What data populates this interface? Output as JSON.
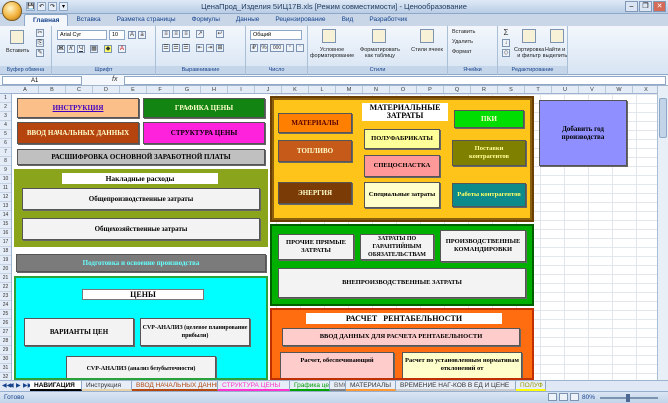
{
  "window": {
    "title": "ЦенаПрод_Изделия 5ИЦ17В.xls  [Режим совместимости] - Ценообразование",
    "qat": [
      "💾",
      "↶",
      "↷",
      "▾"
    ],
    "controls": [
      "–",
      "❐",
      "✕"
    ]
  },
  "ribbon_tabs": [
    "Главная",
    "Вставка",
    "Разметка страницы",
    "Формулы",
    "Данные",
    "Рецензирование",
    "Вид",
    "Разработчик"
  ],
  "ribbon": {
    "clipboard": {
      "paste": "Вставить",
      "label": "Буфер обмена"
    },
    "font": {
      "name": "Arial Cyr",
      "size": "10",
      "bold": "Ж",
      "italic": "К",
      "underline": "Ч",
      "label": "Шрифт"
    },
    "alignment": {
      "label": "Выравнивание"
    },
    "number": {
      "format": "Общий",
      "label": "Число",
      "percent": "%",
      "thousands": "000"
    },
    "styles": {
      "conditional": "Условное форматирование",
      "table": "Форматировать как таблицу",
      "cell": "Стили ячеек",
      "label": "Стили"
    },
    "cells": {
      "insert": "Вставить",
      "delete": "Удалить",
      "format": "Формат",
      "label": "Ячейки"
    },
    "editing": {
      "sort": "Сортировка и фильтр",
      "find": "Найти и выделить",
      "label": "Редактирование",
      "sigma": "Σ"
    }
  },
  "formula_bar": {
    "cell": "A1",
    "fx": "fx",
    "value": ""
  },
  "columns": [
    "A",
    "B",
    "C",
    "D",
    "E",
    "F",
    "G",
    "H",
    "I",
    "J",
    "K",
    "L",
    "M",
    "N",
    "O",
    "P",
    "Q",
    "R",
    "S",
    "T",
    "U",
    "V",
    "W",
    "X"
  ],
  "rows": [
    "1",
    "2",
    "3",
    "4",
    "5",
    "6",
    "7",
    "8",
    "9",
    "10",
    "11",
    "12",
    "13",
    "14",
    "15",
    "16",
    "17",
    "18",
    "19",
    "20",
    "21",
    "22",
    "23",
    "24",
    "25",
    "26",
    "27",
    "28",
    "29",
    "30",
    "31",
    "32"
  ],
  "left_block": {
    "instruction": "ИНСТРУКЦИЯ",
    "price_graph": "ГРАФИКА ЦЕНЫ",
    "input_data": "ВВОД НАЧАЛЬНЫХ ДАННЫХ",
    "price_structure": "СТРУКТУРА ЦЕНЫ",
    "salary": "РАСШИФРОВКА ОСНОВНОЙ ЗАРАБОТНОЙ ПЛАТЫ",
    "overhead_title": "Накладные расходы",
    "general_production": "Общепроизводственные затраты",
    "general_business": "Общехозяйственные затраты",
    "preparation": "Подготовка и освоение производства",
    "prices_title": "ЦЕНЫ",
    "price_variants": "ВАРИАНТЫ ЦЕН",
    "cvp_analysis": "CVP-АНАЛИЗ (целевое планирование прибыли)",
    "cvp_breakeven": "CVP-АНАЛИЗ (анализ безубыточности)"
  },
  "middle_block": {
    "material_title": "МАТЕРИАЛЬНЫЕ ЗАТРАТЫ",
    "materials": "МАТЕРИАЛЫ",
    "pki": "ПКИ",
    "semi": "ПОЛУФАБРИКАТЫ",
    "fuel": "ТОПЛИВО",
    "contractor_supplies": "Поставки контрагентов",
    "special_clothes": "СПЕЦОСНАСТКА",
    "energy": "ЭНЕРГИЯ",
    "special_costs": "Специальные затраты",
    "contractor_work": "Работы контрагентов",
    "other_direct": "ПРОЧИЕ ПРЯМЫЕ ЗАТРАТЫ",
    "warranty": "ЗАТРАТЫ ПО ГАРАНТИЙНЫМ ОБЯЗАТЕЛЬСТВАМ",
    "business_trips": "ПРОИЗВОДСТВЕННЫЕ КОМАНДИРОВКИ",
    "non_production": "ВНЕПРОИЗВОДСТВЕННЫЕ ЗАТРАТЫ",
    "profit_title": "РАСЧЕТ   РЕНТАБЕЛЬНОСТИ",
    "profit_input": "ВВОД ДАННЫХ ДЛЯ РАСЧЕТА РЕНТАБЕЛЬНОСТИ",
    "profit_calc": "Расчет, обеспечивающий",
    "profit_norm": "Расчет по установленным нормативам отклонений от"
  },
  "right_block": {
    "add_year": "Добавить год производства"
  },
  "sheet_tabs": [
    {
      "label": "НАВИГАЦИЯ",
      "color": "#ffffff",
      "text": "#000000",
      "active": true
    },
    {
      "label": "Инструкция",
      "color": "#e8d3a9",
      "text": "#333333",
      "active": false
    },
    {
      "label": "ВВОД НАЧАЛЬНЫХ ДАННЫХ",
      "color": "#b5470f",
      "text": "#b5470f",
      "active": false
    },
    {
      "label": "СТРУКТУРА ЦЕНЫ",
      "color": "#ff33cc",
      "text": "#ff33cc",
      "active": false
    },
    {
      "label": "Графика цены",
      "color": "#00a000",
      "text": "#00a000",
      "active": false
    },
    {
      "label": "ВМС",
      "color": "#808080",
      "text": "#666666",
      "active": false
    },
    {
      "label": "МАТЕРИАЛЫ",
      "color": "#ff9933",
      "text": "#333333",
      "active": false
    },
    {
      "label": "ВРЕМЕНИЕ НАГ-КОВ В ЕД И ЦЕНЕ",
      "color": "#cccccc",
      "text": "#333333",
      "active": false
    },
    {
      "label": "ПОЛУФ",
      "color": "#ffff00",
      "text": "#999900",
      "active": false
    }
  ],
  "status": {
    "ready": "Готово",
    "zoom": "80%"
  }
}
